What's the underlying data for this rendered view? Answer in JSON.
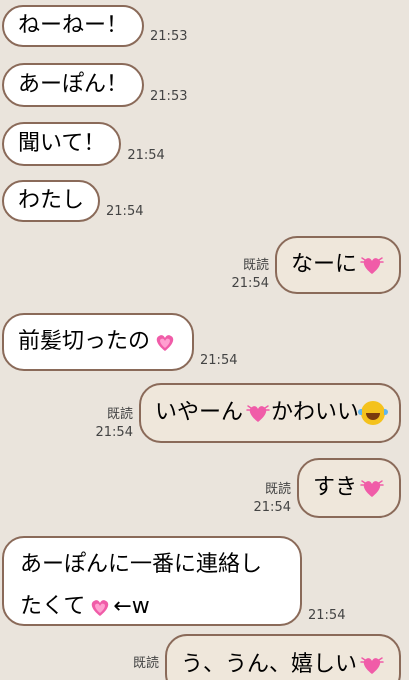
{
  "colors": {
    "background": "#eae4dc",
    "bubble_border": "#8a6a59",
    "incoming_bubble": "#ffffff",
    "outgoing_bubble": "#efe7db",
    "heart": "#f05ca8"
  },
  "messages": [
    {
      "side": "in",
      "text": "ねーねー！",
      "time": "21:53"
    },
    {
      "side": "in",
      "text": "あーぽん！",
      "time": "21:53"
    },
    {
      "side": "in",
      "text": "聞いて！",
      "time": "21:54"
    },
    {
      "side": "in",
      "text": "わたし",
      "time": "21:54"
    },
    {
      "side": "out",
      "text": "なーに",
      "emoji": "sparkling-heart-icon",
      "read": "既読",
      "time": "21:54"
    },
    {
      "side": "in",
      "text": "前髪切ったの",
      "emoji": "sparkling-heart-icon",
      "time": "21:54"
    },
    {
      "side": "out",
      "text_a": "いやーん",
      "text_b": "かわいい",
      "emoji_a": "sparkling-heart-icon",
      "emoji_b": "tears-of-joy-icon",
      "read": "既読",
      "time": "21:54"
    },
    {
      "side": "out",
      "text": "すき",
      "emoji": "sparkling-heart-icon",
      "read": "既読",
      "time": "21:54"
    },
    {
      "side": "in",
      "line1": "あーぽんに一番に連絡し",
      "line2_a": "たくて",
      "line2_b": "←w",
      "emoji": "sparkling-heart-icon",
      "time": "21:54"
    },
    {
      "side": "out",
      "text": "う、うん、嬉しい",
      "emoji": "sparkling-heart-icon",
      "read": "既読",
      "time": ""
    }
  ]
}
